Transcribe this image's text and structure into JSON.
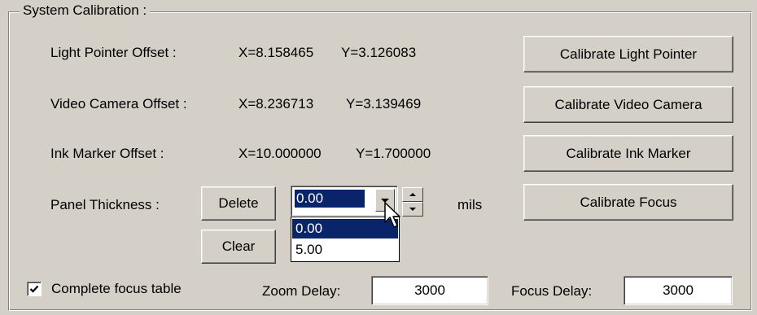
{
  "group": {
    "title": "System Calibration :"
  },
  "offsets": {
    "light_pointer": {
      "label": "Light Pointer Offset :",
      "x": "X=8.158465",
      "y": "Y=3.126083"
    },
    "video_camera": {
      "label": "Video Camera Offset :",
      "x": "X=8.236713",
      "y": "Y=3.139469"
    },
    "ink_marker": {
      "label": "Ink Marker Offset :",
      "x": "X=10.000000",
      "y": "Y=1.700000"
    }
  },
  "buttons": {
    "calibrate_light_pointer": "Calibrate Light Pointer",
    "calibrate_video_camera": "Calibrate Video Camera",
    "calibrate_ink_marker": "Calibrate Ink Marker",
    "calibrate_focus": "Calibrate Focus",
    "delete": "Delete",
    "clear": "Clear"
  },
  "panel_thickness": {
    "label": "Panel Thickness :",
    "value": "0.00",
    "unit": "mils",
    "options": [
      "0.00",
      "5.00"
    ],
    "selected_index": 0
  },
  "focus": {
    "complete_table_label": "Complete focus table",
    "complete_table_checked": true,
    "zoom_delay_label": "Zoom Delay:",
    "zoom_delay_value": "3000",
    "focus_delay_label": "Focus Delay:",
    "focus_delay_value": "3000"
  },
  "icons": {
    "checkmark": "check-icon",
    "dropdown_arrow": "chevron-down-icon",
    "spin_up": "arrow-up-icon",
    "spin_down": "arrow-down-icon",
    "cursor": "mouse-pointer-icon"
  },
  "colors": {
    "face": "#d4d0c8",
    "selection": "#0a246a"
  }
}
